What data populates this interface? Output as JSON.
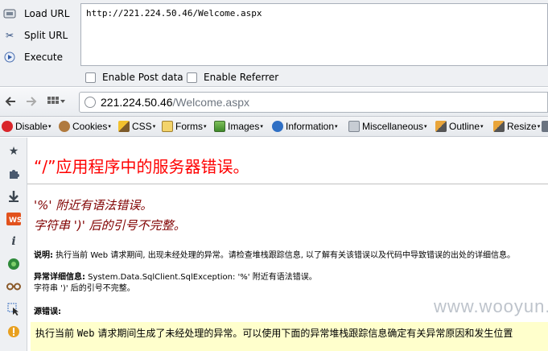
{
  "hackbar": {
    "load_url": "Load URL",
    "split_url": "Split URL",
    "execute": "Execute",
    "url_value": "http://221.224.50.46/Welcome.aspx",
    "enable_post": "Enable Post data",
    "enable_referrer": "Enable Referrer"
  },
  "nav": {
    "address_host": "221.224.50.46",
    "address_path": "/Welcome.aspx"
  },
  "devbar": {
    "items": [
      "Disable",
      "Cookies",
      "CSS",
      "Forms",
      "Images",
      "Information",
      "Miscellaneous",
      "Outline",
      "Resize"
    ]
  },
  "page": {
    "title": "“/”应用程序中的服务器错误。",
    "error_line1": "'%' 附近有语法错误。",
    "error_line2": "字符串 ')' 后的引号不完整。",
    "desc_label": "说明:",
    "desc_text": " 执行当前 Web 请求期间, 出现未经处理的异常。请检查堆栈跟踪信息, 以了解有关该错误以及代码中导致错误的出处的详细信息。",
    "exc_label": "异常详细信息:",
    "exc_text": " System.Data.SqlClient.SqlException: '%' 附近有语法错误。",
    "exc_line2": "字符串 ')' 后的引号不完整。",
    "source_label": "源错误:",
    "source_pre": "执行当前 ",
    "source_web": "Web",
    "source_post": " 请求期间生成了未经处理的异常。可以使用下面的异常堆栈跟踪信息确定有关异常原因和发生位置",
    "watermark": "www.wooyun.org"
  },
  "colors": {
    "title_red": "#ff0000",
    "error_maroon": "#800000",
    "source_bg": "#ffffcc"
  }
}
